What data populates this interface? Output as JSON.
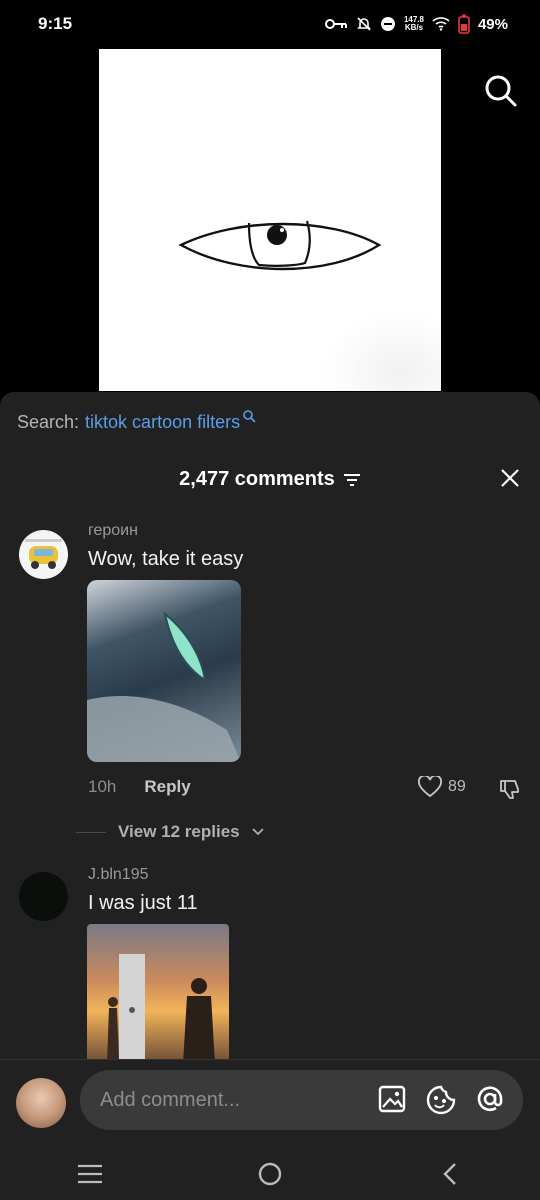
{
  "status_bar": {
    "time": "9:15",
    "net_speed_value": "147.8",
    "net_speed_unit": "KB/s",
    "battery": "49%",
    "icons": [
      "key-icon",
      "bell-off-icon",
      "do-not-disturb-icon",
      "wifi-icon",
      "battery-icon"
    ]
  },
  "search": {
    "label": "Search:",
    "query": "tiktok cartoon filters"
  },
  "comments": {
    "count_label": "2,477 comments",
    "items": [
      {
        "username": "героин",
        "text": "Wow, take it easy",
        "time": "10h",
        "reply_label": "Reply",
        "likes": "89",
        "view_replies": "View 12 replies"
      },
      {
        "username": "J.bln195",
        "text": "I was just 11"
      }
    ]
  },
  "composer": {
    "placeholder": "Add comment..."
  },
  "colors": {
    "sheet_bg": "#212121",
    "link": "#5a9ded"
  }
}
